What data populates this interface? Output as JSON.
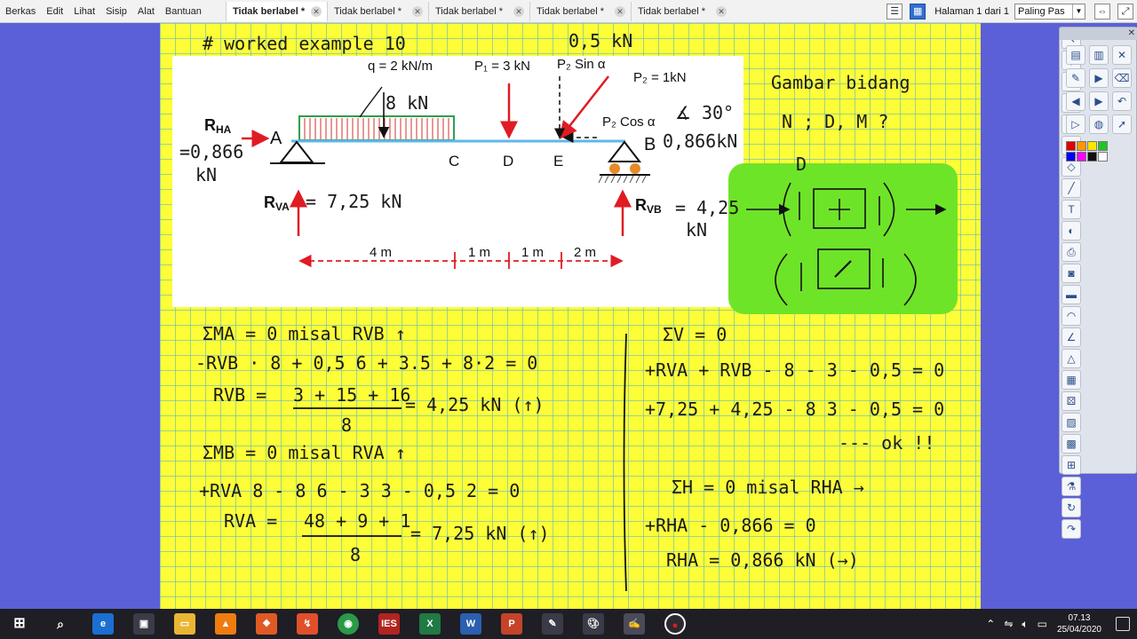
{
  "menu": [
    "Berkas",
    "Edit",
    "Lihat",
    "Sisip",
    "Alat",
    "Bantuan"
  ],
  "tabs": [
    {
      "label": "Tidak berlabel *",
      "active": true
    },
    {
      "label": "Tidak berlabel *",
      "active": false
    },
    {
      "label": "Tidak berlabel *",
      "active": false
    },
    {
      "label": "Tidak berlabel *",
      "active": false
    },
    {
      "label": "Tidak berlabel *",
      "active": false
    }
  ],
  "page_info": "Halaman 1 dari 1",
  "zoom": "Paling Pas",
  "colors": {
    "background": "#5b5fd8",
    "page": "#fdfd38",
    "grid": "#50afd7",
    "highlight": "#6ee428",
    "load": "#2e9f4a",
    "arrow": "#e01b24",
    "beam": "#5eb8ea"
  },
  "diagram": {
    "q": "q = 2 kN/m",
    "p1": "P₁ = 3 kN",
    "p2_sin": "P₂ Sin α",
    "p2": "P₂ = 1kN",
    "p2_cos": "P₂ Cos α",
    "rha": "R",
    "rha_sub": "HA",
    "rva": "R",
    "rva_sub": "VA",
    "rvb": "R",
    "rvb_sub": "VB",
    "pt_a": "A",
    "pt_b": "B",
    "pt_c": "C",
    "pt_d": "D",
    "pt_e": "E",
    "d1": "4 m",
    "d2": "1 m",
    "d3": "1 m",
    "d4": "2 m"
  },
  "handwriting": {
    "title": "# worked example 10",
    "p2sin_val": "0,5 kN",
    "angle": "∡ 30°",
    "b_val": "0,866kN",
    "rha_val_1": "=0,866",
    "rha_val_2": "kN",
    "rva_val": "= 7,25 kN",
    "rvb_val_1": "= 4,25",
    "rvb_val_2": "kN",
    "load_val": "8 kN",
    "gambar_1": "Gambar bidang",
    "gambar_2": "N ; D, M ?",
    "green_d": "D",
    "eq1": "ΣMA = 0    misal RVB ↑",
    "eq2": "-RVB · 8 + 0,5 6 + 3.5 + 8·2 = 0",
    "eq3a": "RVB =",
    "eq3b": "3 + 15 + 16",
    "eq3c": "8",
    "eq3d": "= 4,25 kN (↑)",
    "eq4": "ΣMB = 0    misal RVA ↑",
    "eq5": "+RVA 8 - 8 6 - 3 3 - 0,5 2 = 0",
    "eq6a": "RVA =",
    "eq6b": "48 + 9 + 1",
    "eq6c": "8",
    "eq6d": "= 7,25 kN (↑)",
    "eq7": "ΣV = 0",
    "eq8": "+RVA + RVB - 8 - 3 - 0,5 = 0",
    "eq9": "+7,25 + 4,25 - 8  3 - 0,5 = 0",
    "eq10": "--- ok !!",
    "eq11": "ΣH = 0  misal RHA →",
    "eq12": "+RHA - 0,866 = 0",
    "eq13": "RHA = 0,866 kN (→)"
  },
  "toolbar_icons": [
    "page-icon",
    "notes-icon",
    "close-icon",
    "board-icon",
    "presentation-icon",
    "clear-icon",
    "back-icon",
    "forward-icon",
    "undo-icon",
    "play-icon",
    "globe-icon",
    "arrow-icon",
    "select-icon",
    "zoom-icon",
    "hand-icon",
    "pen-icon",
    "highlighter-icon",
    "eraser-icon",
    "shapes-icon",
    "line-icon",
    "text-icon",
    "fill-icon",
    "capture-icon",
    "camera-icon",
    "ruler-icon",
    "protractor-icon",
    "compass-icon",
    "triangle-icon",
    "calculator-icon",
    "dice-icon",
    "image-icon",
    "gallery-icon",
    "grid-icon",
    "flask-icon",
    "refresh-icon",
    "redo-icon"
  ],
  "palette": [
    "#e00000",
    "#ff9900",
    "#ffe600",
    "#21c521",
    "#0000ff",
    "#ff00ff",
    "#111111",
    "#ffffff"
  ],
  "taskbar": {
    "apps": [
      "start-icon",
      "search-icon",
      "edge-icon",
      "store-icon",
      "explorer-icon",
      "vlc-icon",
      "fox-icon",
      "wps-icon",
      "chrome-icon",
      "ies-icon",
      "excel-icon",
      "word-icon",
      "powerpoint-icon",
      "pen-app-icon",
      "paint-icon",
      "board-app-icon",
      "record-icon"
    ],
    "time": "07.13",
    "date": "25/04/2020"
  }
}
